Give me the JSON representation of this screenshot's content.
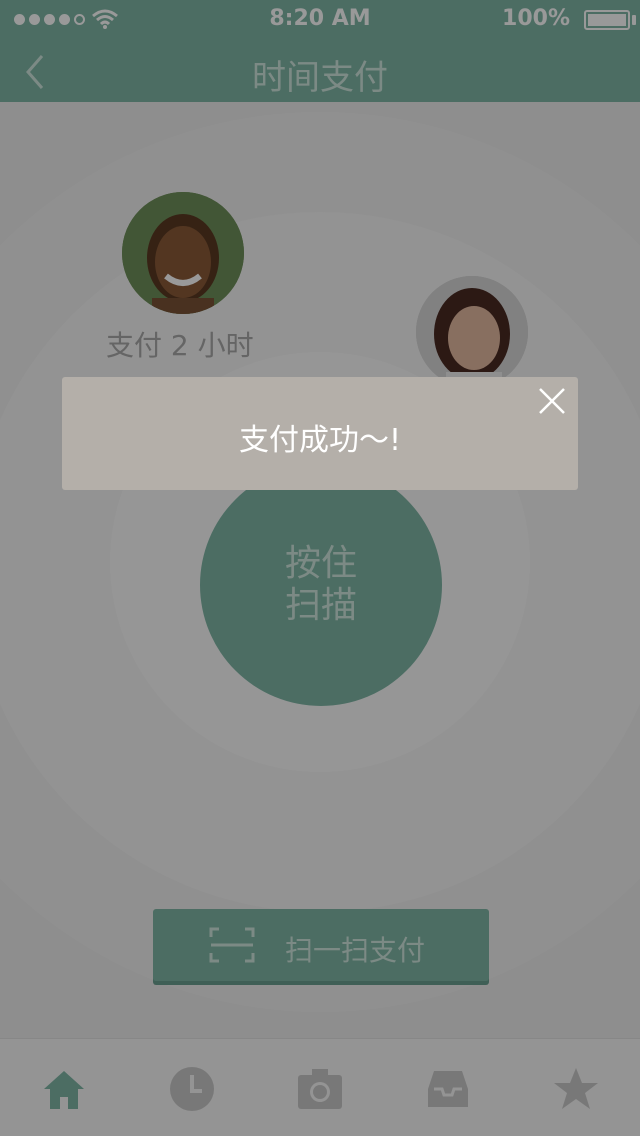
{
  "status_bar": {
    "time": "8:20 AM",
    "battery": "100%"
  },
  "nav": {
    "title": "时间支付",
    "back_icon": "chevron-left-icon"
  },
  "main": {
    "pay_hours_text": "支付 2 小时",
    "scan_circle_line1": "按住",
    "scan_circle_line2": "扫描",
    "scan_button_label": "扫一扫支付"
  },
  "toast": {
    "message": "支付成功～!"
  },
  "tabs": [
    "home-icon",
    "clock-icon",
    "camera-icon",
    "inbox-icon",
    "star-icon"
  ],
  "colors": {
    "accent": "#7fb6a6",
    "overlay": "rgba(0,0,0,0.4)",
    "toast_bg": "#b4afa9"
  }
}
